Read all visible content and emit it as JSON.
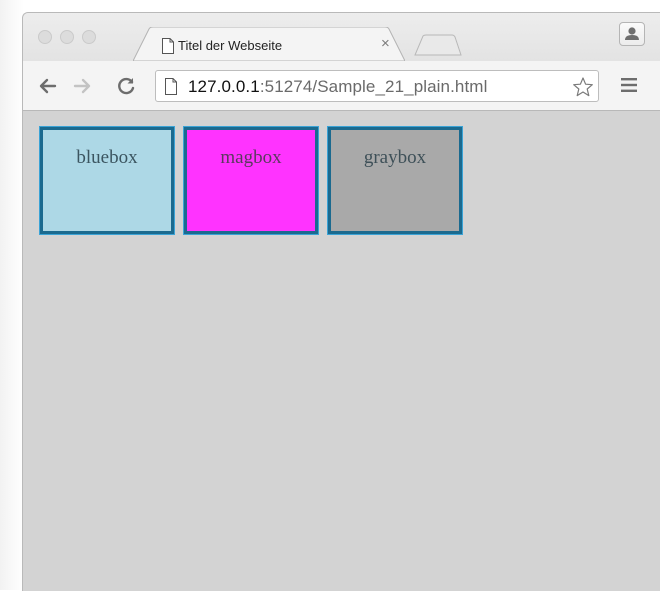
{
  "browser": {
    "tab": {
      "title": "Titel der Webseite",
      "close_glyph": "×",
      "icon": "page-icon"
    },
    "address_bar": {
      "url_host": "127.0.0.1",
      "url_rest": ":51274/Sample_21_plain.html",
      "icon": "page-icon"
    },
    "toolbar_icons": [
      "back-arrow-icon",
      "forward-arrow-icon",
      "reload-icon",
      "star-icon",
      "menu-icon"
    ],
    "window_controls": [
      "close",
      "minimize",
      "zoom"
    ],
    "profile_icon": "person-icon"
  },
  "page": {
    "background": "#d3d3d3",
    "boxes": [
      {
        "label": "bluebox",
        "color": "#add8e6"
      },
      {
        "label": "magbox",
        "color": "#ff33ff"
      },
      {
        "label": "graybox",
        "color": "#a9a9a9"
      }
    ],
    "box_border_color": "#1b6a8f"
  }
}
